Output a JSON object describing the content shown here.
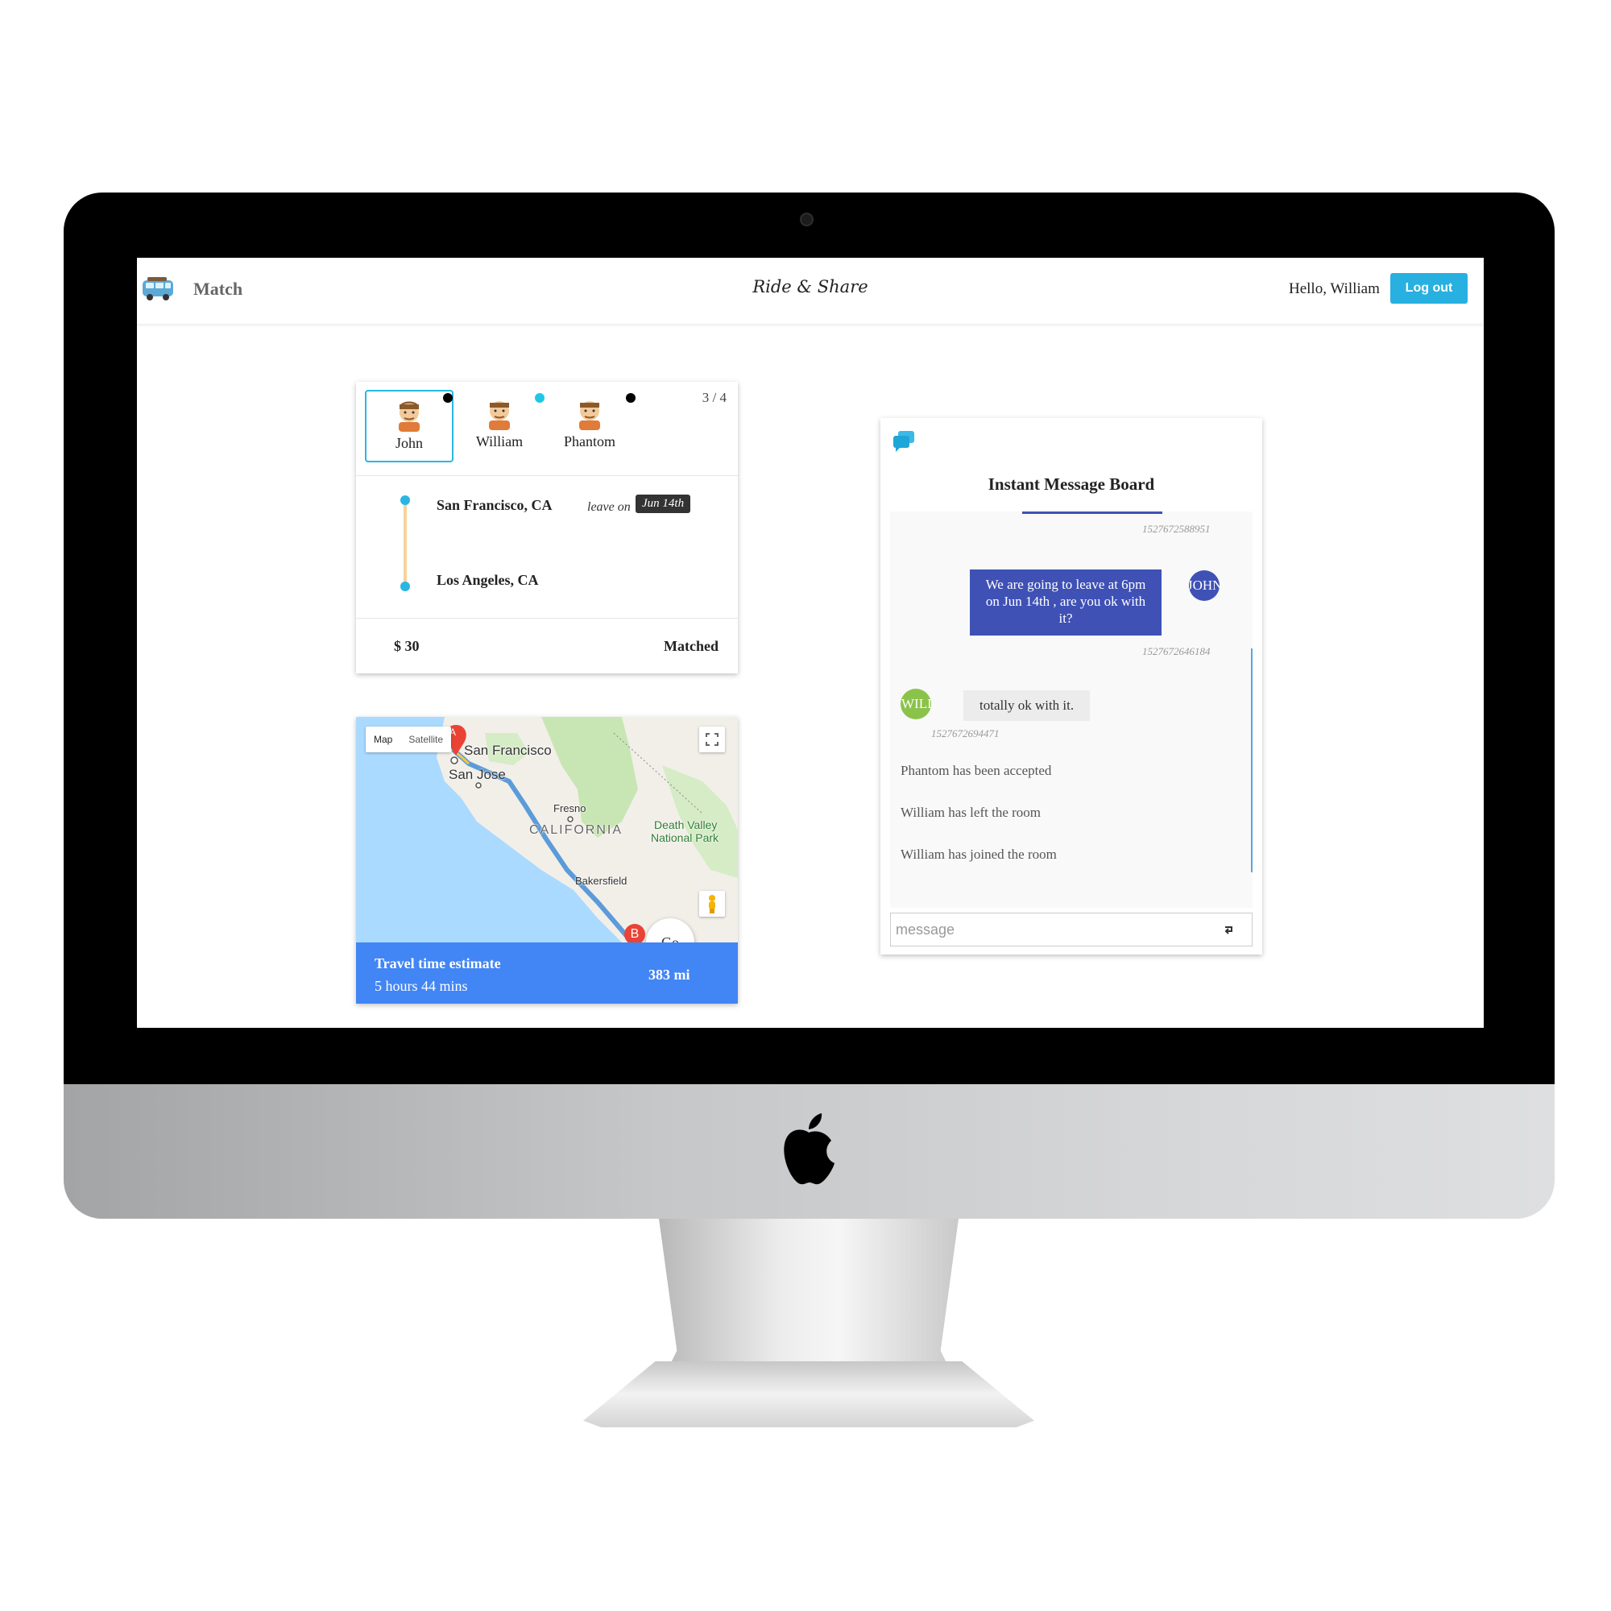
{
  "navbar": {
    "brand": "Match",
    "center_title": "Ride & Share",
    "greeting": "Hello, William",
    "logout_label": "Log out"
  },
  "match_card": {
    "riders": [
      {
        "name": "John",
        "selected": true,
        "dot": "black"
      },
      {
        "name": "William",
        "selected": false,
        "dot": "cyan"
      },
      {
        "name": "Phantom",
        "selected": false,
        "dot": "black"
      }
    ],
    "count": "3 / 4",
    "origin": "San Francisco, CA",
    "destination": "Los Angeles, CA",
    "leave_label": "leave on",
    "leave_date": "Jun 14th",
    "price": "$ 30",
    "status": "Matched"
  },
  "map_card": {
    "map_type_map": "Map",
    "map_type_satellite": "Satellite",
    "labels": {
      "san_francisco": "San Francisco",
      "san_jose": "San Jose",
      "fresno": "Fresno",
      "california": "CALIFORNIA",
      "death_valley": "Death Valley",
      "national_park": "National Park",
      "bakersfield": "Bakersfield"
    },
    "marker_a": "A",
    "marker_b": "B",
    "go_label": "Go",
    "estimate_title": "Travel time estimate",
    "estimate_time": "5 hours 44 mins",
    "distance": "383 mi",
    "colors": {
      "water": "#aadaff",
      "land": "#f2efe9",
      "park": "#c8e6b4",
      "route": "#5b9bd9",
      "estimate_bg": "#4285f4"
    }
  },
  "chat": {
    "title": "Instant Message Board",
    "messages": [
      {
        "timestamp": "1527672588951"
      },
      {
        "text": "We are going to leave at 6pm on Jun 14th , are you ok with it?",
        "avatar": "JOHN",
        "timestamp": "1527672646184"
      },
      {
        "text": "totally ok with it.",
        "avatar": "WILLIAM",
        "timestamp": "1527672694471"
      }
    ],
    "system": [
      "Phantom has been accepted",
      "William has left the room",
      "William has joined the room"
    ],
    "input_placeholder": "message",
    "colors": {
      "outgoing": "#3f51b5",
      "incoming": "#ececec",
      "john_avatar": "#3f51b5",
      "william_avatar": "#8bc34a"
    }
  },
  "icons": [
    "van-icon",
    "user-face-icon",
    "chat-icon",
    "fullscreen-icon",
    "pegman-icon",
    "send-icon",
    "apple-logo-icon"
  ]
}
